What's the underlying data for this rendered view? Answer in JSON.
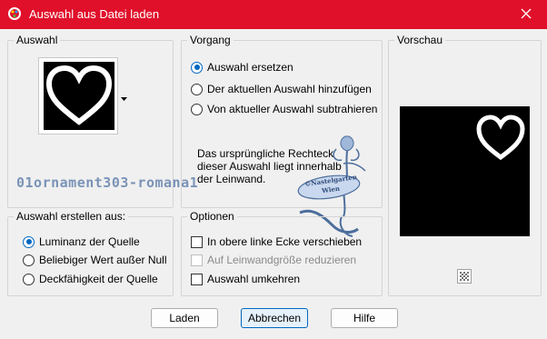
{
  "window": {
    "title": "Auswahl aus Datei laden",
    "titlebar_color": "#e0102a"
  },
  "auswahl_group": {
    "title": "Auswahl"
  },
  "vorgang_group": {
    "title": "Vorgang",
    "options": [
      {
        "label": "Auswahl ersetzen",
        "selected": true
      },
      {
        "label": "Der aktuellen Auswahl hinzufügen",
        "selected": false
      },
      {
        "label": "Von aktueller Auswahl subtrahieren",
        "selected": false
      }
    ],
    "info": "Das ursprüngliche Rechteck dieser Auswahl liegt innerhalb der Leinwand."
  },
  "vorschau_group": {
    "title": "Vorschau"
  },
  "erstellen_group": {
    "title": "Auswahl erstellen aus:",
    "options": [
      {
        "label": "Luminanz der Quelle",
        "selected": true
      },
      {
        "label": "Beliebiger Wert außer Null",
        "selected": false
      },
      {
        "label": "Deckfähigkeit der Quelle",
        "selected": false
      }
    ]
  },
  "optionen_group": {
    "title": "Optionen",
    "checks": [
      {
        "label": "In obere linke Ecke verschieben",
        "checked": false,
        "enabled": true
      },
      {
        "label": "Auf Leinwandgröße reduzieren",
        "checked": false,
        "enabled": false
      },
      {
        "label": "Auswahl umkehren",
        "checked": false,
        "enabled": true
      }
    ]
  },
  "buttons": {
    "load": "Laden",
    "cancel": "Abbrechen",
    "help": "Hilfe"
  },
  "watermark": {
    "text": "01ornament303-romana1",
    "stamp_line1": "©Nastelgarten",
    "stamp_line2": "Wien"
  },
  "icons": {
    "app": "paint-app-icon",
    "close": "close-icon",
    "heart": "heart-icon",
    "dropdown": "chevron-down-icon",
    "checker": "transparency-checker-icon"
  }
}
